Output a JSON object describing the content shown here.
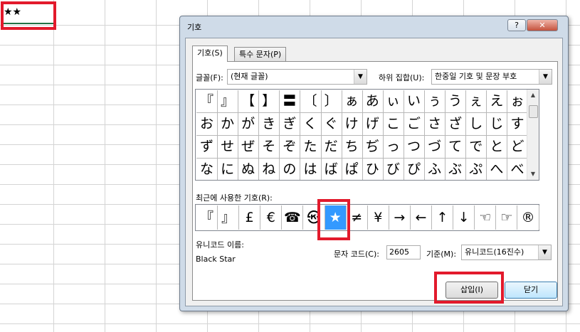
{
  "spreadsheet": {
    "cell_a1": "★★"
  },
  "dialog": {
    "title": "기호",
    "help_glyph": "?",
    "close_glyph": "✕",
    "tabs": [
      {
        "label": "기호(S)"
      },
      {
        "label": "특수 문자(P)"
      }
    ],
    "font_label": "글꼴(F):",
    "font_value": "(현재 글꼴)",
    "subset_label": "하위 집합(U):",
    "subset_value": "한중일 기호 및 문장 부호",
    "symbol_grid": [
      [
        "『",
        "』",
        "【",
        "】",
        "〓",
        "〔",
        "〕",
        "ぁ",
        "あ",
        "ぃ",
        "い",
        "ぅ",
        "う",
        "ぇ",
        "え",
        "ぉ"
      ],
      [
        "お",
        "か",
        "が",
        "き",
        "ぎ",
        "く",
        "ぐ",
        "け",
        "げ",
        "こ",
        "ご",
        "さ",
        "ざ",
        "し",
        "じ",
        "す"
      ],
      [
        "ず",
        "せ",
        "ぜ",
        "そ",
        "ぞ",
        "た",
        "だ",
        "ち",
        "ぢ",
        "っ",
        "つ",
        "づ",
        "て",
        "で",
        "と",
        "ど"
      ],
      [
        "な",
        "に",
        "ぬ",
        "ね",
        "の",
        "は",
        "ば",
        "ぱ",
        "ひ",
        "び",
        "ぴ",
        "ふ",
        "ぶ",
        "ぷ",
        "へ",
        "べ"
      ]
    ],
    "recent_label": "최근에 사용한 기호(R):",
    "recent_symbols": [
      "『",
      "』",
      "£",
      "€",
      "☎",
      "㉿",
      "★",
      "≠",
      "¥",
      "→",
      "←",
      "↑",
      "↓",
      "☜",
      "☞",
      "®"
    ],
    "recent_selected_index": 6,
    "unicode_name_label": "유니코드 이름:",
    "unicode_name_value": "Black Star",
    "char_code_label": "문자 코드(C):",
    "char_code_value": "2605",
    "from_label": "기준(M):",
    "from_value": "유니코드(16진수)",
    "insert_button": "삽입(I)",
    "close_button": "닫기"
  },
  "colors": {
    "highlight_box": "#e21a2c",
    "selection_fill": "#3399ff",
    "dialog_frame": "#cfdbe8"
  }
}
